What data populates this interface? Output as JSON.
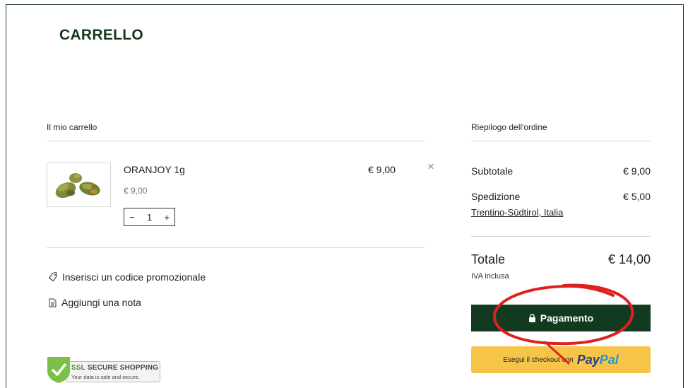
{
  "page": {
    "title": "CARRELLO"
  },
  "cart": {
    "label": "Il mio carrello",
    "items": [
      {
        "name": "ORANJOY 1g",
        "unit_price": "€ 9,00",
        "quantity": "1",
        "line_total": "€ 9,00"
      }
    ],
    "promo_link": "Inserisci un codice promozionale",
    "note_link": "Aggiungi una nota"
  },
  "summary": {
    "label": "Riepilogo dell'ordine",
    "subtotal_label": "Subtotale",
    "subtotal_value": "€ 9,00",
    "shipping_label": "Spedizione",
    "shipping_value": "€ 5,00",
    "shipping_region": "Trentino-Südtirol, Italia",
    "total_label": "Totale",
    "total_value": "€ 14,00",
    "vat_note": "IVA inclusa",
    "checkout_label": "Pagamento",
    "paypal_prefix": "Esegui il checkout con",
    "paypal_brand_a": "Pay",
    "paypal_brand_b": "Pal"
  },
  "badge": {
    "title_a": "SSL",
    "title_b": "SECURE SHOPPING",
    "subtitle": "Your data is safe and secure."
  },
  "colors": {
    "brand_green": "#123a21",
    "paypal_yellow": "#f7c44a",
    "annotation_red": "#e0201e"
  },
  "icons": {
    "remove": "close-icon",
    "promo": "tag-icon",
    "note": "note-icon",
    "checkout": "lock-icon",
    "ssl": "shield-check-icon"
  }
}
